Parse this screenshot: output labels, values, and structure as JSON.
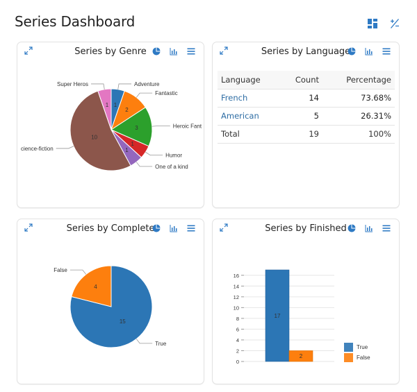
{
  "page": {
    "title": "Series Dashboard",
    "actions": [
      {
        "icon": "layout-icon",
        "label": "Layout"
      },
      {
        "icon": "plus-minus-icon",
        "label": "Add/Remove"
      }
    ]
  },
  "colors": {
    "accent": "#2e7ac4",
    "blue": "#2c76b5",
    "orange": "#fd7f0e",
    "green": "#2ca02c",
    "red": "#d62728",
    "purple": "#9467bd",
    "brown": "#8c564b",
    "pink": "#e377c2",
    "link": "#2e6da4"
  },
  "cards": {
    "genre": {
      "title": "Series by Genre"
    },
    "language": {
      "title": "Series by Language"
    },
    "complete": {
      "title": "Series by Complete"
    },
    "finished": {
      "title": "Series by Finished"
    }
  },
  "language_table": {
    "headers": [
      "Language",
      "Count",
      "Percentage"
    ],
    "rows": [
      {
        "language": "French",
        "count": "14",
        "percentage": "73.68%"
      },
      {
        "language": "American",
        "count": "5",
        "percentage": "26.31%"
      }
    ],
    "total": {
      "label": "Total",
      "count": "19",
      "percentage": "100%"
    }
  },
  "chart_data": [
    {
      "id": "genre",
      "type": "pie",
      "title": "Series by Genre",
      "categories": [
        "Adventure",
        "Fantastic",
        "Heroic Fant",
        "Humor",
        "One of a kind",
        "cience-fiction",
        "Super Heros"
      ],
      "values": [
        1,
        2,
        3,
        1,
        1,
        10,
        1
      ],
      "colors": [
        "#2c76b5",
        "#fd7f0e",
        "#2ca02c",
        "#d62728",
        "#9467bd",
        "#8c564b",
        "#e377c2"
      ]
    },
    {
      "id": "complete",
      "type": "pie",
      "title": "Series by Complete",
      "categories": [
        "True",
        "False"
      ],
      "values": [
        15,
        4
      ],
      "colors": [
        "#2c76b5",
        "#fd7f0e"
      ]
    },
    {
      "id": "finished",
      "type": "bar",
      "title": "Series by Finished",
      "categories": [
        "True",
        "False"
      ],
      "values": [
        17,
        2
      ],
      "colors": [
        "#2c76b5",
        "#fd7f0e"
      ],
      "ylim": [
        0,
        17
      ],
      "yticks": [
        0,
        2,
        4,
        6,
        8,
        10,
        12,
        14,
        16
      ],
      "grid": true,
      "legend": "bottom-right",
      "xlabel": "",
      "ylabel": ""
    }
  ]
}
